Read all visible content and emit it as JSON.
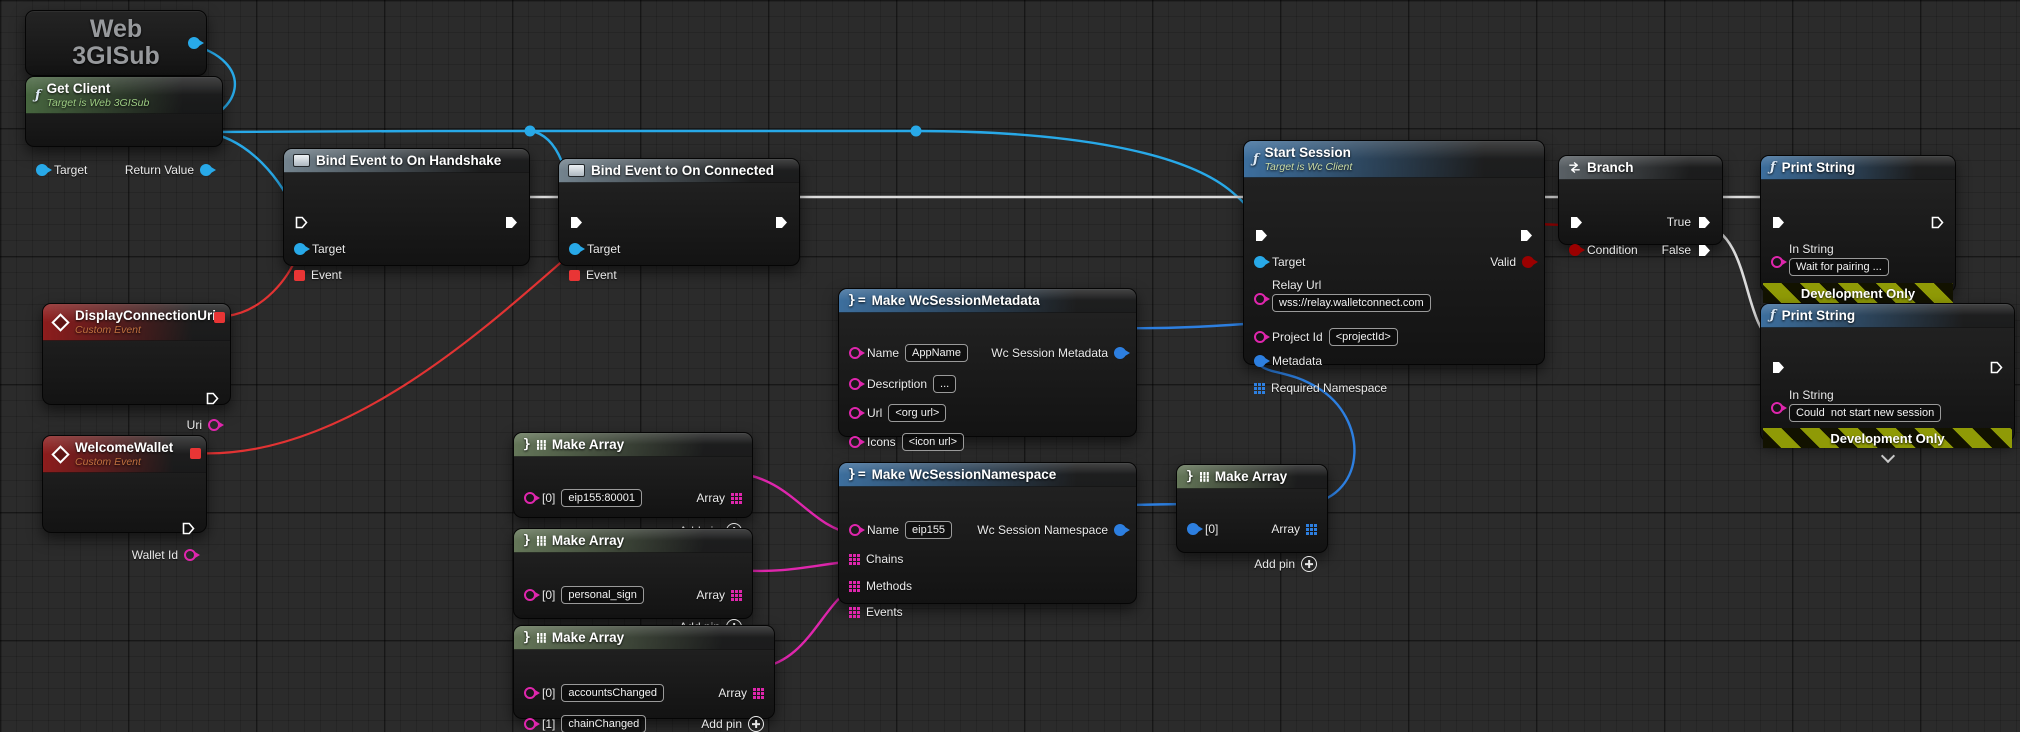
{
  "colors": {
    "exec_wire": "#dcdcdc",
    "object_wire": "#28a9e8",
    "struct_wire": "#2d7fe0",
    "string_wire": "#df26ad",
    "delegate_wire": "#e23333",
    "bool_wire": "#9b0000",
    "header_function_blue": "#3d6f9e",
    "header_function_green": "#47663f",
    "header_make_array": "#657759",
    "header_bind_event": "#74848f",
    "header_branch": "#5a6166",
    "header_custom_event": "#8e1d1d",
    "dev_banner_stripe": "#8f9a06"
  },
  "icons": {
    "function": "ƒ",
    "struct_brace": "}",
    "struct_eq": "=",
    "array_brace": "}"
  },
  "nodes": {
    "web3gisub": {
      "title_line1": "Web",
      "title_line2": "3GISub"
    },
    "get_client": {
      "title": "Get Client",
      "subtitle": "Target is Web 3GISub",
      "target": "Target",
      "return_value": "Return Value"
    },
    "bind_handshake": {
      "title": "Bind Event to On Handshake",
      "target": "Target",
      "event": "Event"
    },
    "bind_connected": {
      "title": "Bind Event to On Connected",
      "target": "Target",
      "event": "Event"
    },
    "display_uri": {
      "title": "DisplayConnectionUri",
      "subtitle": "Custom Event",
      "uri": "Uri"
    },
    "welcome_wallet": {
      "title": "WelcomeWallet",
      "subtitle": "Custom Event",
      "wallet_id": "Wallet Id"
    },
    "make_metadata": {
      "title": "Make WcSessionMetadata",
      "name": "Name",
      "name_value": "AppName",
      "description": "Description",
      "description_value": "...",
      "url": "Url",
      "url_value": "<org url>",
      "icons": "Icons",
      "icons_value": "<icon url>",
      "out": "Wc Session Metadata"
    },
    "make_namespace": {
      "title": "Make WcSessionNamespace",
      "name": "Name",
      "name_value": "eip155",
      "chains": "Chains",
      "methods": "Methods",
      "events": "Events",
      "out": "Wc Session Namespace"
    },
    "array_chains": {
      "title": "Make Array",
      "i0": "[0]",
      "i0_value": "eip155:80001",
      "array": "Array",
      "add_pin": "Add pin"
    },
    "array_methods": {
      "title": "Make Array",
      "i0": "[0]",
      "i0_value": "personal_sign",
      "array": "Array",
      "add_pin": "Add pin"
    },
    "array_events": {
      "title": "Make Array",
      "i0": "[0]",
      "i0_value": "accountsChanged",
      "i1": "[1]",
      "i1_value": "chainChanged",
      "array": "Array",
      "add_pin": "Add pin"
    },
    "array_namespaces": {
      "title": "Make Array",
      "i0": "[0]",
      "array": "Array",
      "add_pin": "Add pin"
    },
    "start_session": {
      "title": "Start Session",
      "subtitle": "Target is Wc Client",
      "target": "Target",
      "valid": "Valid",
      "relay_url": "Relay Url",
      "relay_url_value": "wss://relay.walletconnect.com",
      "project_id": "Project Id",
      "project_id_value": "<projectId>",
      "metadata": "Metadata",
      "required_namespace": "Required Namespace"
    },
    "branch": {
      "title": "Branch",
      "condition": "Condition",
      "true_label": "True",
      "false_label": "False"
    },
    "print_wait": {
      "title": "Print String",
      "in_string": "In String",
      "in_string_value": "Wait for pairing ...",
      "banner": "Development Only"
    },
    "print_fail": {
      "title": "Print String",
      "in_string": "In String",
      "in_string_value": "Could  not start new session",
      "banner": "Development Only"
    }
  }
}
